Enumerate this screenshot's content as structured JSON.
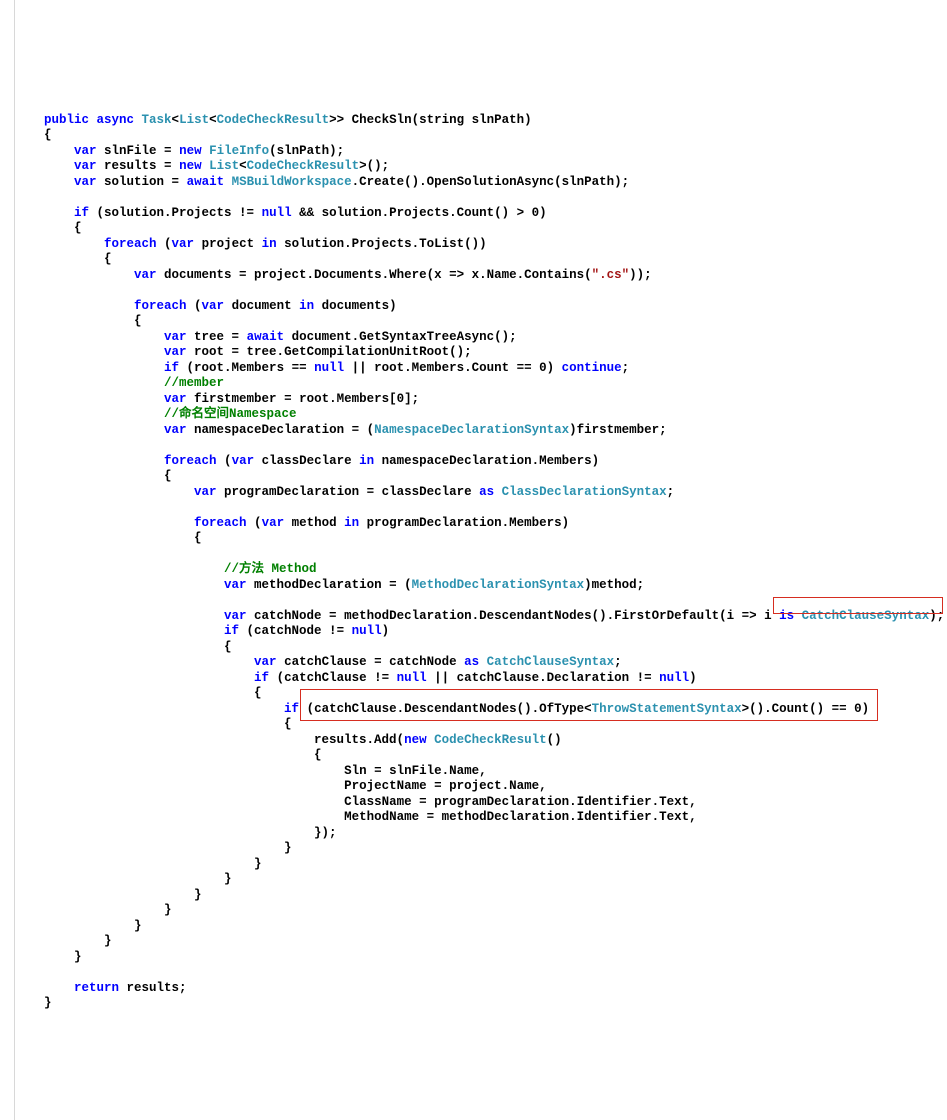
{
  "code": {
    "sig_pre": "public async ",
    "task": "Task",
    "list": "List",
    "ccr": "CodeCheckResult",
    "sig_post": ">> ",
    "method_name": "CheckSln",
    "sig_params": "(string slnPath)",
    "var": "var",
    "new": "new",
    "await": "await",
    "if": "if",
    "foreach": "foreach",
    "in": "in",
    "return": "return",
    "null": "null",
    "continue": "continue",
    "as": "as",
    "is": "is",
    "slnFile": "slnFile = ",
    "FileInfo": "FileInfo",
    "slnFile_args": "(slnPath);",
    "results_decl": "results = ",
    "results_args": ">();",
    "solution_decl": "solution = ",
    "msws": "MSBuildWorkspace",
    "create": ".Create().OpenSolutionAsync(slnPath);",
    "if_solution": " (solution.Projects != ",
    "if_solution2": " && solution.Projects.Count() > 0)",
    "foreach_proj1": " (",
    "foreach_proj2": " project ",
    "foreach_proj3": " solution.Projects.ToList())",
    "docs_decl": " documents = project.Documents.Where(x => x.Name.Contains(",
    "cs_str": "\".cs\"",
    "docs_decl2": "));",
    "foreach_doc1": " document ",
    "foreach_doc2": " documents)",
    "tree_decl": " tree = ",
    "tree_decl2": " document.GetSyntaxTreeAsync();",
    "root_decl": " root = tree.GetCompilationUnitRoot();",
    "if_root": " (root.Members == ",
    "if_root2": " || root.Members.Count == 0) ",
    "if_root3": ";",
    "member_comment": "//member",
    "firstmember": " firstmember = root.Members[0];",
    "ns_comment": "//命名空间Namespace",
    "nsd_decl": " namespaceDeclaration = (",
    "nds": "NamespaceDeclarationSyntax",
    "nsd_decl2": ")firstmember;",
    "foreach_cls1": " classDeclare ",
    "foreach_cls2": " namespaceDeclaration.Members)",
    "progdecl1": " programDeclaration = classDeclare ",
    "cds": "ClassDeclarationSyntax",
    "progdecl2": ";",
    "foreach_mtd1": " method ",
    "foreach_mtd2": " programDeclaration.Members)",
    "method_comment": "//方法 Method",
    "mdecl1": " methodDeclaration = (",
    "mds": "MethodDeclarationSyntax",
    "mdecl2": ")method;",
    "catchnode1": " catchNode = methodDeclaration.DescendantNodes().FirstOrDefault(i => i ",
    "ccs": "CatchClauseSyntax",
    "catchnode2": ");",
    "if_catchnode": " (catchNode != ",
    "if_catchnode2": ")",
    "catchclause1": " catchClause = catchNode ",
    "catchclause2": ";",
    "if_cc": " (catchClause != ",
    "if_cc2": " || catchClause.Declaration != ",
    "if_cc3": ")",
    "if_descend1": " (catchClause.DescendantNodes().OfType<",
    "tss": "ThrowStatementSyntax",
    "if_descend2": ">().Count() == 0)",
    "resadd1": "results.Add(",
    "resadd2": "()",
    "sln_assign": "Sln = slnFile.Name,",
    "proj_assign": "ProjectName = project.Name,",
    "class_assign": "ClassName = programDeclaration.Identifier.Text,",
    "method_assign": "MethodName = methodDeclaration.Identifier.Text,",
    "close_add": "});",
    "return_stmt": " results;"
  }
}
